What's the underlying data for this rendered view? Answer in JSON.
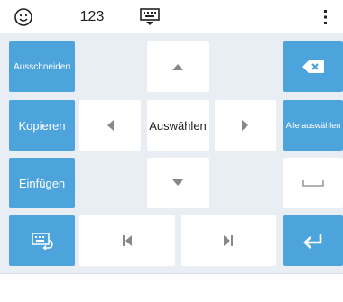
{
  "toolbar": {
    "emoji_icon": "smiley-face-icon",
    "numbers_label": "123",
    "keyboard_icon": "keyboard-down-icon",
    "menu_icon": "vertical-dots-icon"
  },
  "keys": {
    "cut_label": "Ausschneiden",
    "copy_label": "Kopieren",
    "paste_label": "Einfügen",
    "select_label": "Auswählen",
    "select_all_label": "Alle auswählen"
  },
  "colors": {
    "accent": "#4da3dc",
    "keyboard_bg": "#e8eef3",
    "key_white": "#ffffff"
  }
}
